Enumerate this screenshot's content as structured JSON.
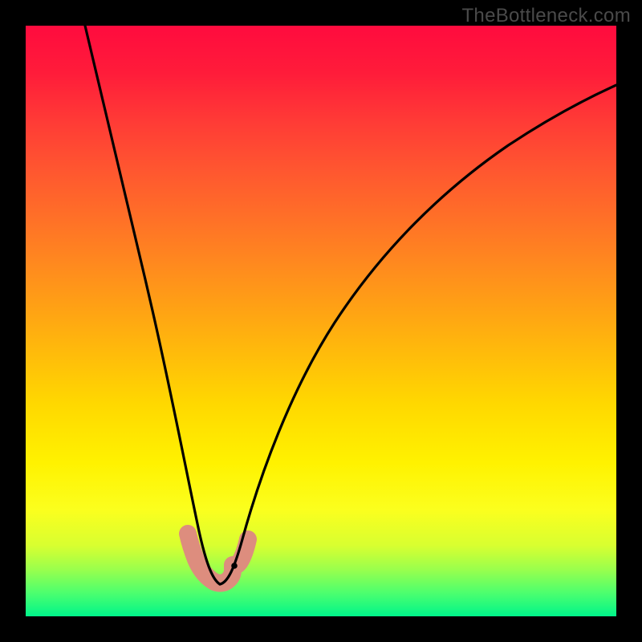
{
  "watermark": "TheBottleneck.com",
  "colors": {
    "frame": "#000000",
    "curve": "#000000",
    "salmon": "#dd8d7e",
    "gradient_stops": [
      "#ff0b3e",
      "#ff6e28",
      "#ffd800",
      "#fff200",
      "#4dff6e",
      "#00f58a"
    ]
  },
  "chart_data": {
    "type": "line",
    "title": "",
    "xlabel": "",
    "ylabel": "",
    "xlim": [
      0,
      100
    ],
    "ylim": [
      0,
      100
    ],
    "grid": false,
    "legend": false,
    "note": "Axes are implicit (no tick labels shown). x is horizontal position (% of plot width), y is vertical position (% of plot height, 0 = top). Curve estimated from pixels.",
    "series": [
      {
        "name": "bottleneck-curve",
        "x": [
          10,
          12,
          14,
          16,
          18,
          20,
          22,
          24,
          26,
          28,
          29,
          30,
          31,
          32,
          33,
          34,
          35,
          37,
          40,
          44,
          48,
          52,
          56,
          60,
          66,
          74,
          82,
          90,
          100
        ],
        "y": [
          0,
          8,
          17,
          26,
          35,
          44,
          53,
          62,
          71,
          80,
          85,
          89,
          92,
          93.5,
          93.5,
          92,
          89,
          84,
          76,
          66,
          58,
          51,
          45,
          40,
          33,
          26,
          20,
          15,
          10
        ]
      }
    ],
    "highlight_segment": {
      "description": "Salmon-colored thick overlay near the curve minimum",
      "x": [
        27.5,
        28.5,
        29.3,
        30.3,
        31.3,
        32.3,
        33.0,
        33.8,
        34.6,
        35.4
      ],
      "y": [
        86.0,
        89.0,
        91.5,
        93.0,
        93.5,
        93.0,
        92.0,
        90.5,
        88.5,
        86.0
      ]
    }
  }
}
